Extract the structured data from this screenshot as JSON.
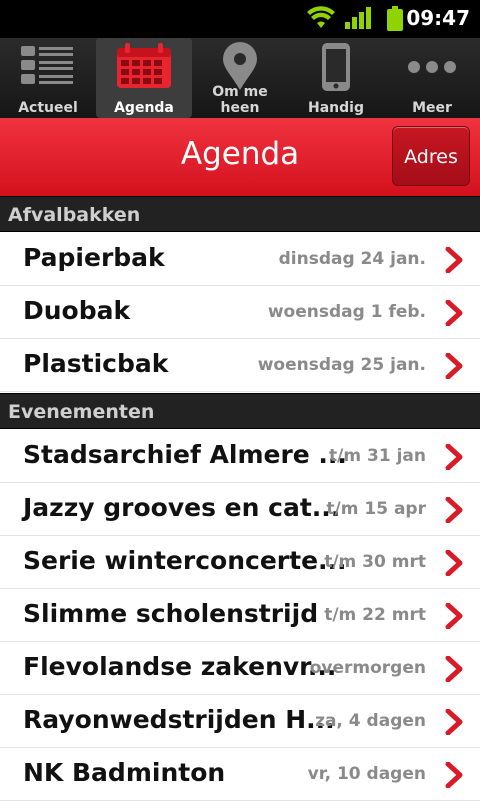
{
  "status_bar": {
    "time": "09:47",
    "icons": [
      "wifi-icon",
      "signal-icon",
      "battery-icon"
    ]
  },
  "tabs": [
    {
      "label": "Actueel",
      "icon": "list-icon",
      "active": false
    },
    {
      "label": "Agenda",
      "icon": "calendar-icon",
      "active": true
    },
    {
      "label": "Om me heen",
      "icon": "map-pin-icon",
      "active": false
    },
    {
      "label": "Handig",
      "icon": "phone-icon",
      "active": false
    },
    {
      "label": "Meer",
      "icon": "more-dots-icon",
      "active": false
    }
  ],
  "header": {
    "title": "Agenda",
    "adres_label": "Adres"
  },
  "sections": [
    {
      "title": "Afvalbakken",
      "items": [
        {
          "name": "Papierbak",
          "date": "dinsdag 24 jan."
        },
        {
          "name": "Duobak",
          "date": "woensdag 1 feb."
        },
        {
          "name": "Plasticbak",
          "date": "woensdag 25 jan."
        }
      ]
    },
    {
      "title": "Evenementen",
      "items": [
        {
          "name": "Stadsarchief Almere ...",
          "date": "t/m 31 jan"
        },
        {
          "name": "Jazzy grooves en cat...",
          "date": "t/m 15 apr"
        },
        {
          "name": "Serie winterconcerte...",
          "date": "t/m 30 mrt"
        },
        {
          "name": "Slimme scholenstrijd",
          "date": "t/m 22 mrt"
        },
        {
          "name": "Flevolandse zakenvr...",
          "date": "overmorgen"
        },
        {
          "name": "Rayonwedstrijden H...",
          "date": "za, 4 dagen"
        },
        {
          "name": "NK Badminton",
          "date": "vr, 10 dagen"
        }
      ]
    }
  ],
  "colors": {
    "accent_red": "#e0202c",
    "chevron_red": "#d81b27",
    "section_bg": "#222222"
  }
}
